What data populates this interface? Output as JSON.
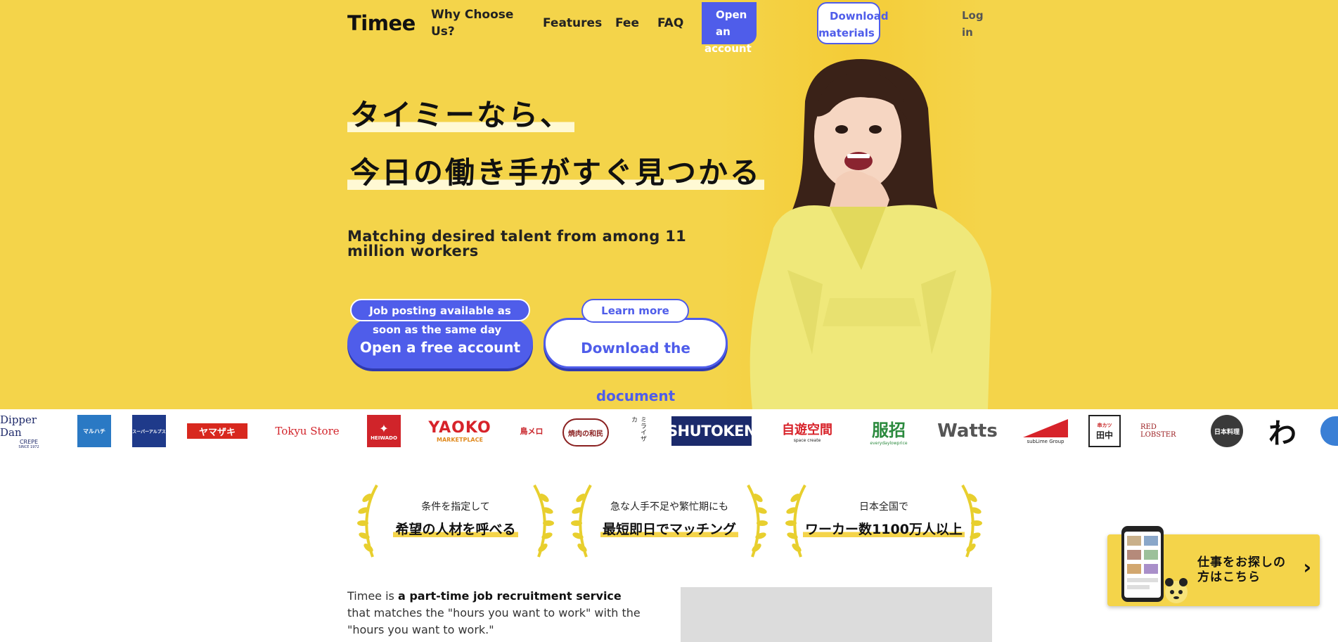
{
  "header": {
    "logo": "Timee",
    "nav": {
      "why": "Why Choose Us?",
      "features": "Features",
      "fee": "Fee",
      "faq": "FAQ",
      "open_account_1": "Open an",
      "open_account_2": "account",
      "download_1": "Download",
      "download_2": "materials",
      "login_1": "Log",
      "login_2": "in"
    }
  },
  "hero": {
    "headline_1": "タイミーなら、",
    "headline_2": "今日の働き手がすぐ見つかる",
    "subline": "Matching desired talent from among 11 million workers",
    "cta_primary": "Open a free account",
    "cta_primary_tag_1": "Job posting available as",
    "cta_primary_tag_2": "soon as the same day",
    "cta_secondary": "Download the document",
    "cta_secondary_tag": "Learn more"
  },
  "brands": [
    "Dipper Dan",
    "マルハチ",
    "スーパーアルプス",
    "ヤマザキ",
    "Tokyu Store",
    "HEIWADO",
    "YAOKO",
    "鳥メロ",
    "焼肉の和民",
    "ミライザカ",
    "SHUTOKEN",
    "自遊空間",
    "服招",
    "Watts",
    "subLime Group",
    "田中",
    "RED LOBSTER",
    "日本料理",
    "わ"
  ],
  "brand_sub": {
    "dipper": "CREPE",
    "dipper_since": "SINCE 1972",
    "yaoko_sub": "MARKETPLACE",
    "heiwado_mark": "HEIWADO",
    "jiyu_sub": "space create",
    "fuku_sub": "everydaylowprice",
    "tanaka_sub": "串カツ"
  },
  "awards": [
    {
      "small": "条件を指定して",
      "big": "希望の人材を呼べる"
    },
    {
      "small": "急な人手不足や繁忙期にも",
      "big": "最短即日でマッチング"
    },
    {
      "small": "日本全国で",
      "big": "ワーカー数1100万人以上"
    }
  ],
  "intro": {
    "p1_a": "Timee is ",
    "p1_b": "a part-time job recruitment service",
    "p1_c": " that matches the \"hours you want to work\" with the \"hours you want to work.\""
  },
  "float_banner": {
    "text": "仕事をお探しの方はこちら",
    "chevron": "›"
  },
  "colors": {
    "hero_bg": "#f4d44a",
    "primary": "#4f5dea"
  }
}
